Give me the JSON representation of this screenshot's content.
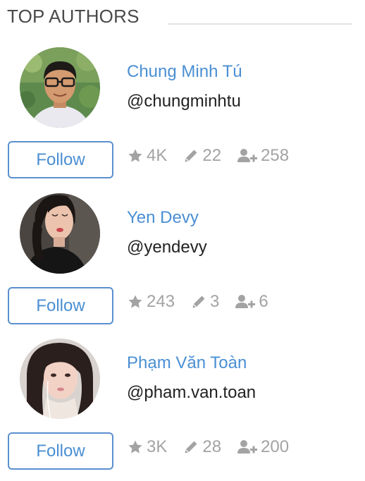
{
  "widget": {
    "title": "TOP AUTHORS"
  },
  "authors": [
    {
      "name": "Chung Minh Tú",
      "handle": "@chungminhtu",
      "follow_label": "Follow",
      "stars": "4K",
      "posts": "22",
      "followers": "258"
    },
    {
      "name": "Yen Devy",
      "handle": "@yendevy",
      "follow_label": "Follow",
      "stars": "243",
      "posts": "3",
      "followers": "6"
    },
    {
      "name": "Phạm Văn Toàn",
      "handle": "@pham.van.toan",
      "follow_label": "Follow",
      "stars": "3K",
      "posts": "28",
      "followers": "200"
    }
  ],
  "icons": {
    "star": "star-icon",
    "pencil": "pencil-icon",
    "user_plus": "user-plus-icon"
  },
  "colors": {
    "link_blue": "#4a8fd3",
    "button_border": "#5b8fcf",
    "stat_gray": "#a3a3a3",
    "title_gray": "#4a4a4a"
  }
}
